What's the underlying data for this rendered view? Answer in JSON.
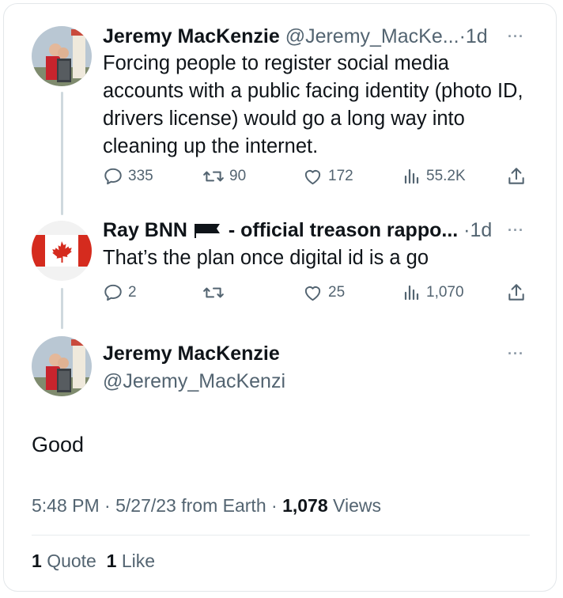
{
  "tweet1": {
    "author_name": "Jeremy MacKenzie",
    "handle": "@Jeremy_MacKe...",
    "separator": "·",
    "time": "1d",
    "more": "···",
    "text": "Forcing people to register social media accounts with a public facing identity (photo ID, drivers license) would go a long way into cleaning up the internet.",
    "replies": "335",
    "retweets": "90",
    "likes": "172",
    "views": "55.2K"
  },
  "tweet2": {
    "author_name": "Ray BNN",
    "name_suffix": "- official treason rappo...",
    "separator": "·",
    "time": "1d",
    "more": "···",
    "text": "That’s the plan once digital id is a go",
    "replies": "2",
    "retweets": "",
    "likes": "25",
    "views": "1,070"
  },
  "main_tweet": {
    "author_name": "Jeremy MacKenzie",
    "handle": "@Jeremy_MacKenzi",
    "more": "···",
    "text": "Good",
    "time": "5:48 PM",
    "date": "5/27/23",
    "source": "from Earth",
    "sep": "·",
    "views_count": "1,078",
    "views_label": "Views",
    "quotes_count": "1",
    "quotes_label": "Quote",
    "likes_count": "1",
    "likes_label": "Like"
  },
  "colors": {
    "text": "#0f1419",
    "muted": "#536471",
    "border": "#e3e7ea",
    "canada_red": "#d52b1e"
  }
}
